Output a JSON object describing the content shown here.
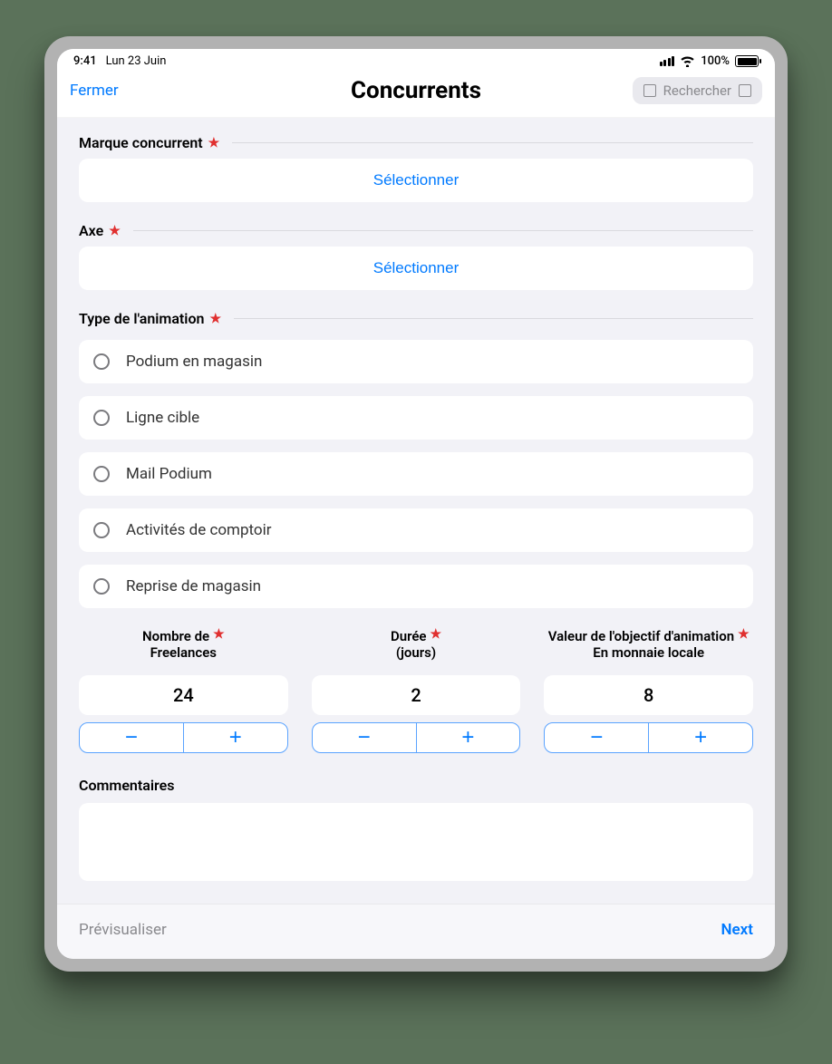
{
  "statusbar": {
    "time": "9:41",
    "date": "Lun 23 Juin",
    "battery_pct": "100%"
  },
  "nav": {
    "close": "Fermer",
    "title": "Concurrents",
    "search_placeholder": "Rechercher"
  },
  "fields": {
    "brand": {
      "label": "Marque concurrent",
      "button": "Sélectionner",
      "required": true
    },
    "axis": {
      "label": "Axe",
      "button": "Sélectionner",
      "required": true
    },
    "animtype": {
      "label": "Type de l'animation",
      "required": true
    },
    "options": [
      "Podium en magasin",
      "Ligne cible",
      "Mail Podium",
      "Activités de comptoir",
      "Reprise de magasin"
    ],
    "freelances": {
      "line1": "Nombre de",
      "line2": "Freelances",
      "value": "24",
      "required": true
    },
    "duration": {
      "line1": "Durée",
      "line2": "(jours)",
      "value": "2",
      "required": true
    },
    "objective": {
      "line1": "Valeur de l'objectif d'animation",
      "line2": "En monnaie locale",
      "value": "8",
      "required": true
    },
    "comments_label": "Commentaires"
  },
  "footer": {
    "preview": "Prévisualiser",
    "next": "Next"
  },
  "glyphs": {
    "star": "★",
    "minus": "−",
    "plus": "+"
  }
}
